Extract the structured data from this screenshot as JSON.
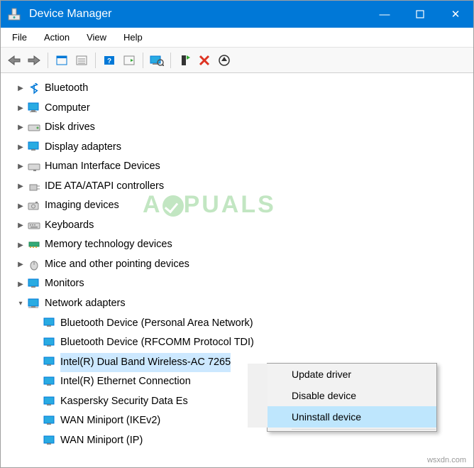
{
  "window": {
    "title": "Device Manager"
  },
  "menu": {
    "file": "File",
    "action": "Action",
    "view": "View",
    "help": "Help"
  },
  "tree": {
    "bluetooth": "Bluetooth",
    "computer": "Computer",
    "disk": "Disk drives",
    "display": "Display adapters",
    "hid": "Human Interface Devices",
    "ide": "IDE ATA/ATAPI controllers",
    "imaging": "Imaging devices",
    "keyboards": "Keyboards",
    "memory": "Memory technology devices",
    "mice": "Mice and other pointing devices",
    "monitors": "Monitors",
    "netadapters": "Network adapters",
    "net": {
      "btpan": "Bluetooth Device (Personal Area Network)",
      "btrfcomm": "Bluetooth Device (RFCOMM Protocol TDI)",
      "intelwifi": "Intel(R) Dual Band Wireless-AC 7265",
      "inteleth": "Intel(R) Ethernet Connection",
      "kaspersky": "Kaspersky Security Data Es",
      "wanikev2": "WAN Miniport (IKEv2)",
      "wanip": "WAN Miniport (IP)"
    }
  },
  "context": {
    "update": "Update driver",
    "disable": "Disable device",
    "uninstall": "Uninstall device"
  },
  "watermark": "A   PUALS",
  "source": "wsxdn.com"
}
